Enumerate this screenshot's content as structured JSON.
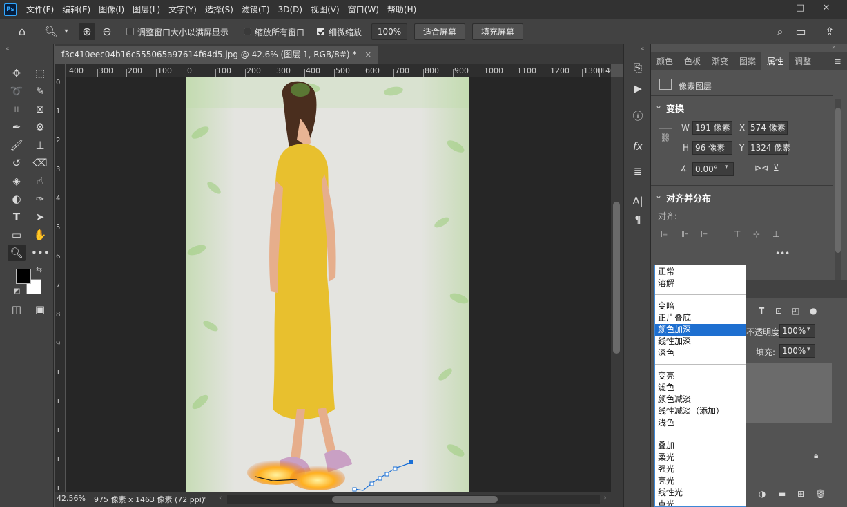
{
  "app": {
    "logo": "Ps"
  },
  "menu": [
    "文件(F)",
    "编辑(E)",
    "图像(I)",
    "图层(L)",
    "文字(Y)",
    "选择(S)",
    "滤镜(T)",
    "3D(D)",
    "视图(V)",
    "窗口(W)",
    "帮助(H)"
  ],
  "window_controls": {
    "minimize": "—",
    "restore": "□",
    "close": "✕"
  },
  "options_bar": {
    "resize_window_label": "调整窗口大小以满屏显示",
    "zoom_all_label": "缩放所有窗口",
    "scrubby_zoom_label": "细微缩放",
    "zoom_value": "100%",
    "fit_screen": "适合屏幕",
    "fill_screen": "填充屏幕"
  },
  "document": {
    "tab_title": "f3c410eec04b16c555065a97614f64d5.jpg @ 42.6% (图层 1, RGB/8#) *",
    "close": "×"
  },
  "ruler_h": [
    "400",
    "300",
    "200",
    "100",
    "0",
    "100",
    "200",
    "300",
    "400",
    "500",
    "600",
    "700",
    "800",
    "900",
    "1000",
    "1100",
    "1200",
    "1300",
    "140"
  ],
  "ruler_v": [
    "0",
    "1",
    "2",
    "3",
    "4",
    "5",
    "6",
    "7",
    "8",
    "9",
    "1",
    "1",
    "1",
    "1",
    "1"
  ],
  "status": {
    "zoom": "42.56%",
    "info": "975 像素 x 1463 像素 (72 ppi)"
  },
  "properties": {
    "tabs": [
      "颜色",
      "色板",
      "渐变",
      "图案",
      "属性",
      "调整"
    ],
    "active_tab": "属性",
    "layer_type": "像素图层",
    "transform_title": "变换",
    "w_label": "W",
    "w_value": "191 像素",
    "x_label": "X",
    "x_value": "574 像素",
    "h_label": "H",
    "h_value": "96 像素",
    "y_label": "Y",
    "y_value": "1324 像素",
    "angle_value": "0.00°",
    "align_title": "对齐并分布",
    "align_label": "对齐:",
    "more": "•••"
  },
  "blend_modes": {
    "groups": [
      [
        "正常",
        "溶解"
      ],
      [
        "变暗",
        "正片叠底",
        "颜色加深",
        "线性加深",
        "深色"
      ],
      [
        "变亮",
        "滤色",
        "颜色减淡",
        "线性减淡（添加）",
        "浅色"
      ],
      [
        "叠加",
        "柔光",
        "强光",
        "亮光",
        "线性光",
        "点光"
      ]
    ],
    "selected": "颜色加深"
  },
  "layers": {
    "opacity_label": "不透明度:",
    "opacity_value": "100%",
    "fill_label": "填充:",
    "fill_value": "100%"
  },
  "colors": {
    "accent": "#1e6fd0",
    "dress": "#e8c02e",
    "foreground": "#000000",
    "background": "#ffffff"
  }
}
